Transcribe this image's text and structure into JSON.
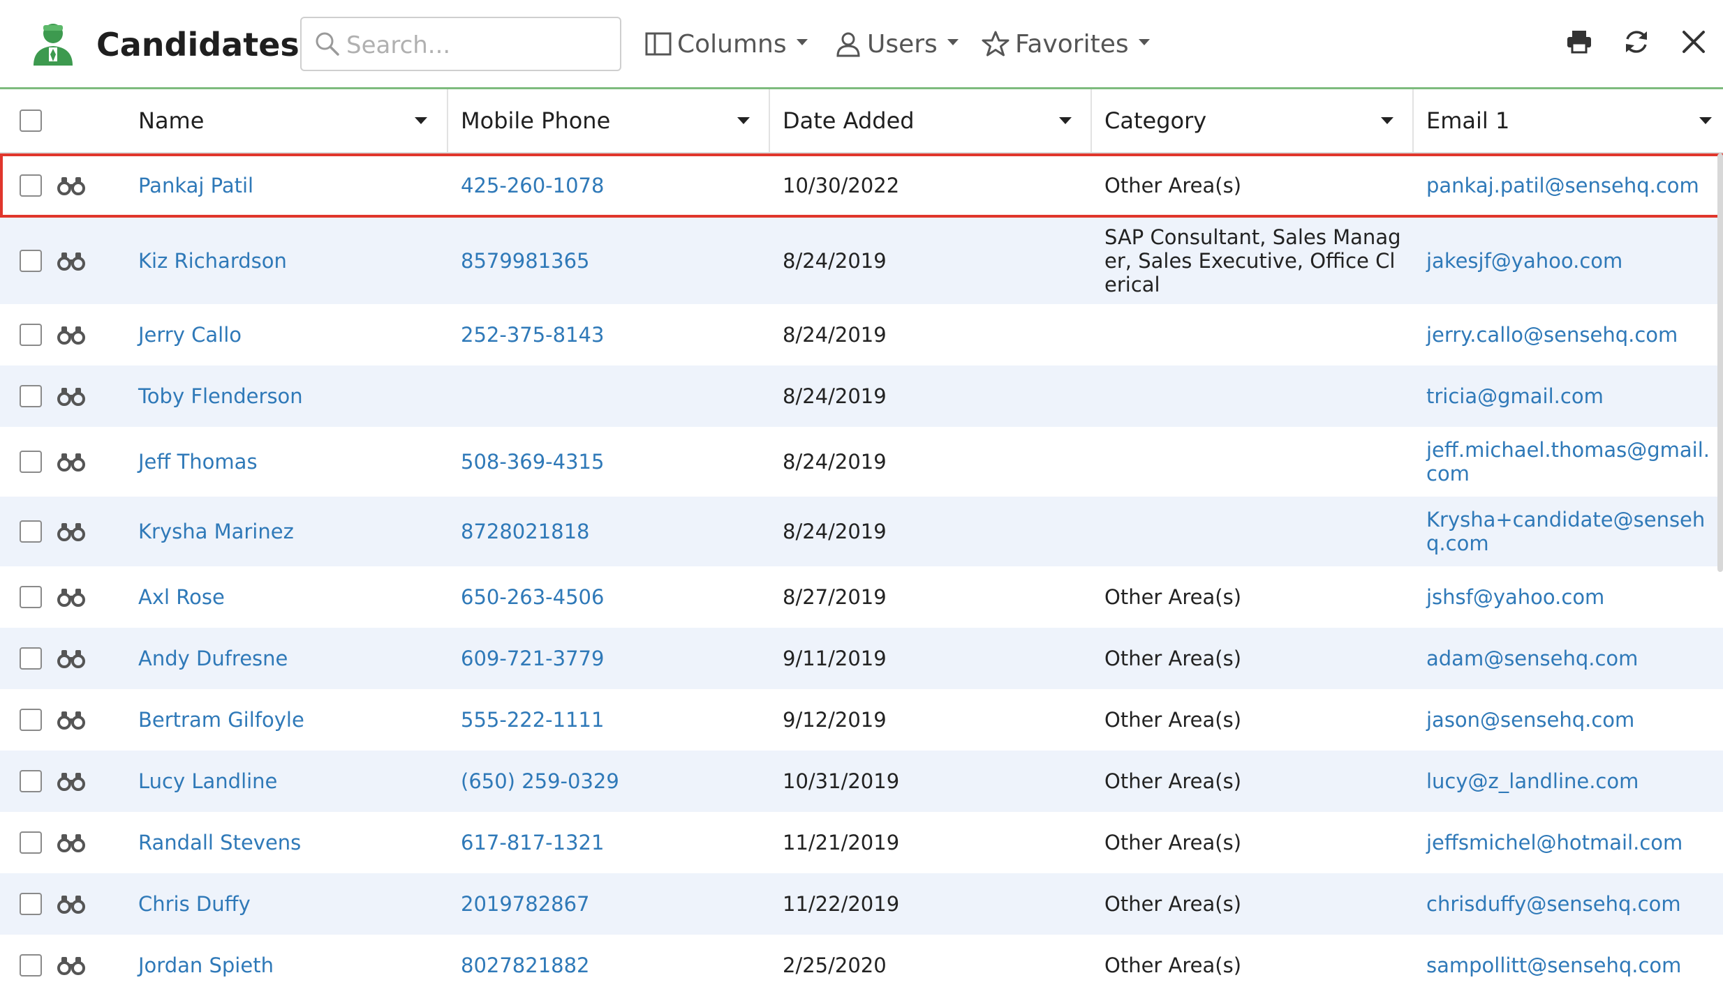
{
  "header": {
    "title": "Candidates",
    "search_placeholder": "Search...",
    "columns_label": "Columns",
    "users_label": "Users",
    "favorites_label": "Favorites",
    "accent_color": "#7dbb7d"
  },
  "columns": [
    "Name",
    "Mobile Phone",
    "Date Added",
    "Category",
    "Email 1"
  ],
  "rows": [
    {
      "name": "Pankaj Patil",
      "phone": "425-260-1078",
      "date": "10/30/2022",
      "category": "Other Area(s)",
      "email": "pankaj.patil@sensehq.com"
    },
    {
      "name": "Kiz Richardson",
      "phone": "8579981365",
      "date": "8/24/2019",
      "category": "SAP Consultant, Sales Manager, Sales Executive, Office Clerical",
      "email": "jakesjf@yahoo.com"
    },
    {
      "name": "Jerry Callo",
      "phone": "252-375-8143",
      "date": "8/24/2019",
      "category": "",
      "email": "jerry.callo@sensehq.com"
    },
    {
      "name": "Toby Flenderson",
      "phone": "",
      "date": "8/24/2019",
      "category": "",
      "email": "tricia@gmail.com"
    },
    {
      "name": "Jeff Thomas",
      "phone": "508-369-4315",
      "date": "8/24/2019",
      "category": "",
      "email": "jeff.michael.thomas@gmail.com"
    },
    {
      "name": "Krysha Marinez",
      "phone": "8728021818",
      "date": "8/24/2019",
      "category": "",
      "email": "Krysha+candidate@sensehq.com"
    },
    {
      "name": "Axl Rose",
      "phone": "650-263-4506",
      "date": "8/27/2019",
      "category": "Other Area(s)",
      "email": "jshsf@yahoo.com"
    },
    {
      "name": "Andy Dufresne",
      "phone": "609-721-3779",
      "date": "9/11/2019",
      "category": "Other Area(s)",
      "email": "adam@sensehq.com"
    },
    {
      "name": "Bertram Gilfoyle",
      "phone": "555-222-1111",
      "date": "9/12/2019",
      "category": "Other Area(s)",
      "email": "jason@sensehq.com"
    },
    {
      "name": "Lucy Landline",
      "phone": "(650) 259-0329",
      "date": "10/31/2019",
      "category": "Other Area(s)",
      "email": "lucy@z_landline.com"
    },
    {
      "name": "Randall Stevens",
      "phone": "617-817-1321",
      "date": "11/21/2019",
      "category": "Other Area(s)",
      "email": "jeffsmichel@hotmail.com"
    },
    {
      "name": "Chris Duffy",
      "phone": "2019782867",
      "date": "11/22/2019",
      "category": "Other Area(s)",
      "email": "chrisduffy@sensehq.com"
    },
    {
      "name": "Jordan Spieth",
      "phone": "8027821882",
      "date": "2/25/2020",
      "category": "Other Area(s)",
      "email": "sampollitt@sensehq.com"
    }
  ],
  "selected_row": 0,
  "colors": {
    "link": "#2f79b8",
    "row_alt": "#eef3fb",
    "selection_border": "#e0362c"
  }
}
